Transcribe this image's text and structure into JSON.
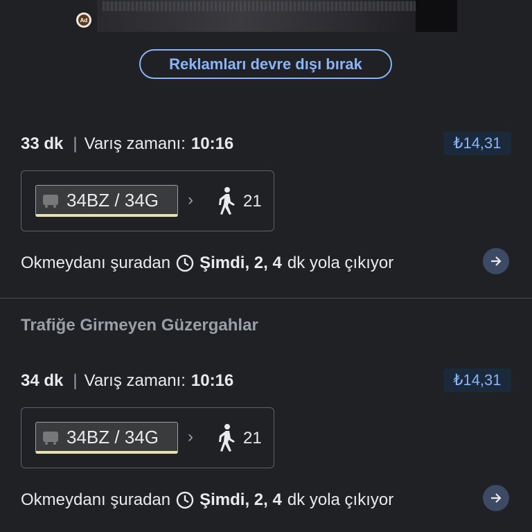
{
  "ad": {
    "badge_icon": "ad-badge-icon",
    "disable_ads_label": "Reklamları devre dışı bırak"
  },
  "routes": [
    {
      "duration": "33 dk",
      "arrival_label": "Varış zamanı:",
      "arrival_time": "10:16",
      "price": "₺14,31",
      "line": "34BZ / 34G",
      "line_color": "#e6e2b1",
      "walk_minutes": "21",
      "stop_text": "Okmeydanı şuradan",
      "now_label": "Şimdi, 2, 4",
      "tail_text": "dk yola çıkıyor"
    },
    {
      "duration": "34 dk",
      "arrival_label": "Varış zamanı:",
      "arrival_time": "10:16",
      "price": "₺14,31",
      "line": "34BZ / 34G",
      "line_color": "#e6e2b1",
      "walk_minutes": "21",
      "stop_text": "Okmeydanı şuradan",
      "now_label": "Şimdi, 2, 4",
      "tail_text": "dk yola çıkıyor"
    }
  ],
  "section": {
    "title": "Trafiğe Girmeyen Güzergahlar"
  },
  "colors": {
    "accent": "#8ab4f8",
    "background": "#202124"
  }
}
